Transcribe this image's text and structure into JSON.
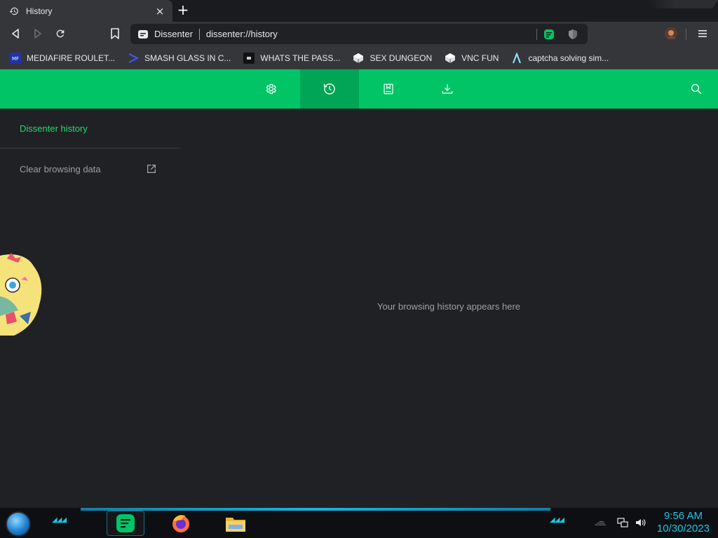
{
  "tab": {
    "title": "History",
    "close": "×",
    "new_tab": "+"
  },
  "omnibox": {
    "site_name": "Dissenter",
    "url": "dissenter://history"
  },
  "bookmarks": [
    {
      "label": "MEDIAFIRE ROULET...",
      "icon": "mediafire-icon",
      "color": "#2233aa"
    },
    {
      "label": "SMASH GLASS IN C...",
      "icon": "bracket-icon",
      "color": "#3d5afe"
    },
    {
      "label": "WHATS THE PASS...",
      "icon": "roblox-icon",
      "color": "#111111"
    },
    {
      "label": "SEX DUNGEON",
      "icon": "cube-icon",
      "color": "#dddddd"
    },
    {
      "label": "VNC FUN",
      "icon": "cube-icon",
      "color": "#dddddd"
    },
    {
      "label": "captcha solving sim...",
      "icon": "lambda-icon",
      "color": "#8ee9ff"
    }
  ],
  "page": {
    "nav": [
      {
        "name": "settings",
        "icon": "gear-icon",
        "active": false
      },
      {
        "name": "history",
        "icon": "history-icon",
        "active": true
      },
      {
        "name": "bookmarks",
        "icon": "bookmark-icon",
        "active": false
      },
      {
        "name": "downloads",
        "icon": "download-icon",
        "active": false
      }
    ],
    "sidebar_title": "Dissenter history",
    "clear_label": "Clear browsing data",
    "empty_message": "Your browsing history appears here",
    "accent": "#00c466",
    "accent_dark": "#00a555"
  },
  "taskbar": {
    "time": "9:56 AM",
    "date": "10/30/2023",
    "deco_left": "◢◢◢",
    "deco_right": "◢◢◢"
  }
}
